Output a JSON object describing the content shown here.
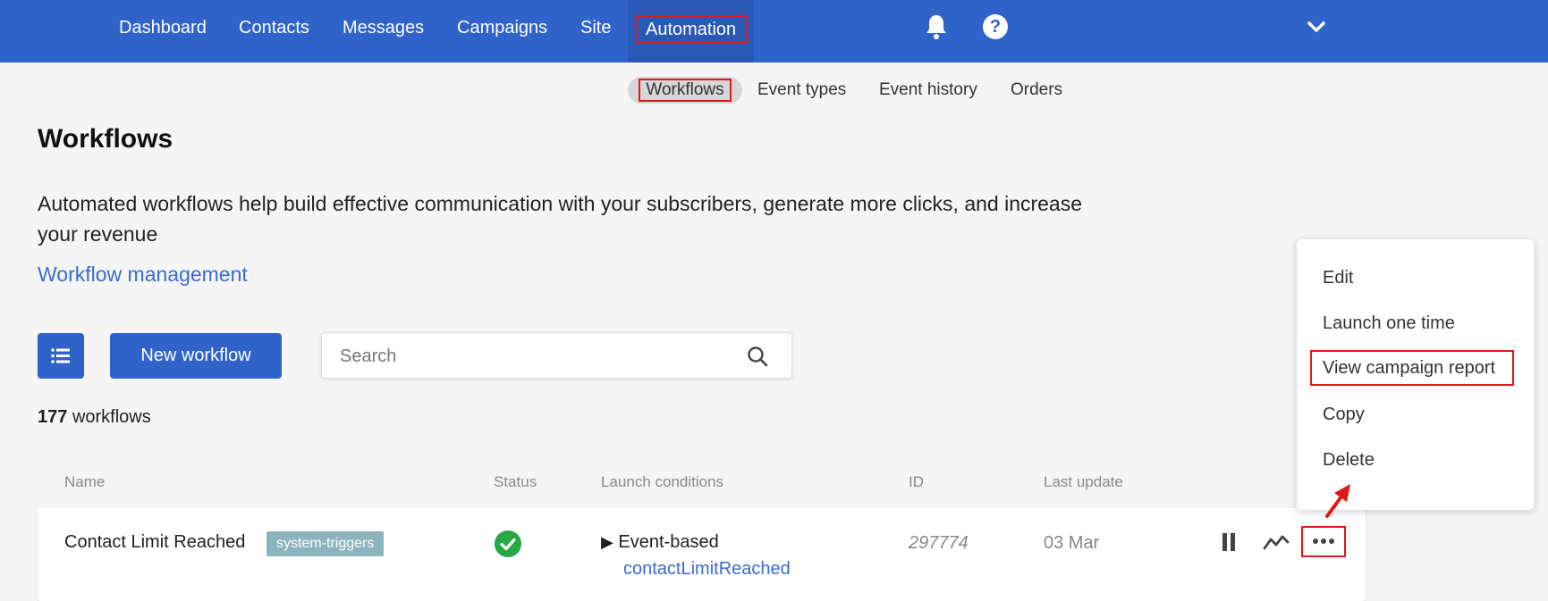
{
  "nav": {
    "items": [
      "Dashboard",
      "Contacts",
      "Messages",
      "Campaigns",
      "Site",
      "Automation"
    ],
    "active": "Automation",
    "bell_icon": "bell-icon",
    "help_icon": "help-icon",
    "help_glyph": "?",
    "chevron_icon": "chevron-down-icon"
  },
  "subtabs": {
    "items": [
      "Workflows",
      "Event types",
      "Event history",
      "Orders"
    ],
    "active": "Workflows"
  },
  "page": {
    "title": "Workflows",
    "description": "Automated workflows help build effective communication with your subscribers, generate more clicks, and increase your revenue",
    "management_link": "Workflow management"
  },
  "toolbar": {
    "list_icon": "list-icon",
    "new_workflow_label": "New workflow",
    "search_placeholder": "Search",
    "search_value": ""
  },
  "count": {
    "number": "177",
    "label": "workflows"
  },
  "table": {
    "headers": [
      "Name",
      "Status",
      "Launch conditions",
      "ID",
      "Last update"
    ],
    "rows": [
      {
        "name": "Contact Limit Reached",
        "tag": "system-triggers",
        "status_icon": "check-circle-icon",
        "launch_type": "Event-based",
        "launch_event": "contactLimitReached",
        "id": "297774",
        "last_update": "03 Mar"
      }
    ]
  },
  "context_menu": {
    "items": [
      "Edit",
      "Launch one time",
      "View campaign report",
      "Copy",
      "Delete"
    ],
    "highlighted": "View campaign report"
  },
  "colors": {
    "brand_blue": "#2f63c9",
    "link_blue": "#3a6bd0",
    "highlight_red": "#e01818",
    "tag_bg": "#8cb4bc",
    "success_green": "#27a844"
  }
}
